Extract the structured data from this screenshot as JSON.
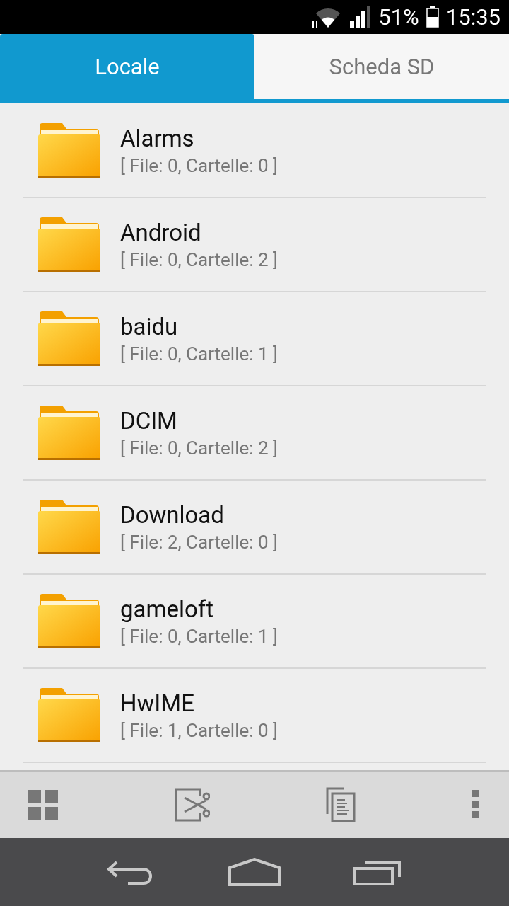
{
  "status_bar": {
    "battery": "51%",
    "time": "15:35"
  },
  "tabs": [
    {
      "label": "Locale",
      "selected": true
    },
    {
      "label": "Scheda SD",
      "selected": false
    }
  ],
  "folders": [
    {
      "name": "Alarms",
      "info": "[ File: 0, Cartelle: 0 ]"
    },
    {
      "name": "Android",
      "info": "[ File: 0, Cartelle: 2 ]"
    },
    {
      "name": "baidu",
      "info": "[ File: 0, Cartelle: 1 ]"
    },
    {
      "name": "DCIM",
      "info": "[ File: 0, Cartelle: 2 ]"
    },
    {
      "name": "Download",
      "info": "[ File: 2, Cartelle: 0 ]"
    },
    {
      "name": "gameloft",
      "info": "[ File: 0, Cartelle: 1 ]"
    },
    {
      "name": "HwIME",
      "info": "[ File: 1, Cartelle: 0 ]"
    }
  ]
}
